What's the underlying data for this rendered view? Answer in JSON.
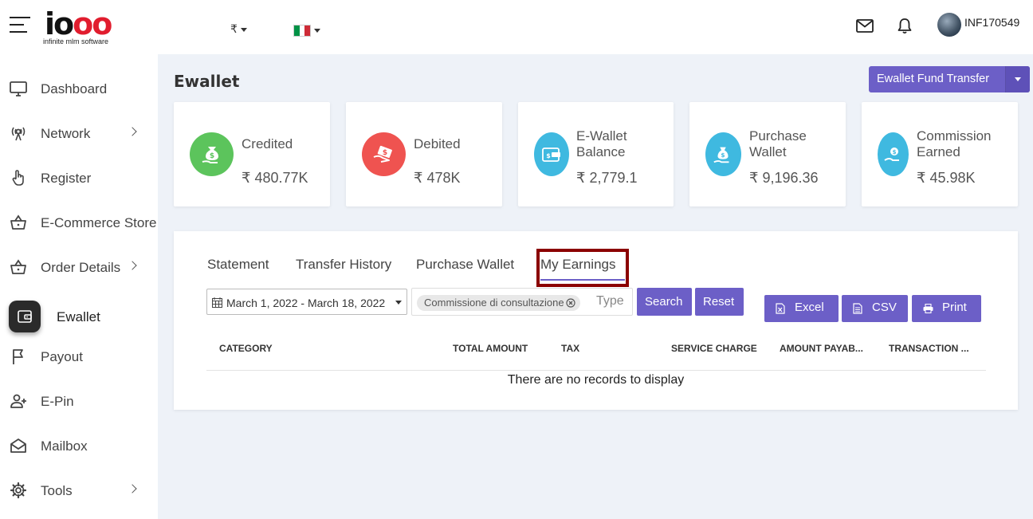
{
  "header": {
    "logo_text": "iooo",
    "logo_subtitle": "infinite mlm software",
    "currency": "₹",
    "user_id": "INF170549"
  },
  "sidebar": {
    "items": [
      {
        "label": "Dashboard",
        "icon": "monitor-icon"
      },
      {
        "label": "Network",
        "icon": "network-icon",
        "chevron": true
      },
      {
        "label": "Register",
        "icon": "hand-pointer-icon"
      },
      {
        "label": "E-Commerce Store",
        "icon": "basket-icon"
      },
      {
        "label": "Order Details",
        "icon": "basket-icon",
        "chevron": true
      },
      {
        "label": "Ewallet",
        "icon": "wallet-icon",
        "active": true
      },
      {
        "label": "Payout",
        "icon": "flag-icon"
      },
      {
        "label": "E-Pin",
        "icon": "user-plus-icon"
      },
      {
        "label": "Mailbox",
        "icon": "envelope-open-icon"
      },
      {
        "label": "Tools",
        "icon": "gear-icon",
        "chevron": true
      }
    ]
  },
  "main": {
    "page_title": "Ewallet",
    "fund_transfer_label": "Ewallet Fund Transfer",
    "cards": [
      {
        "title": "Credited",
        "value": "₹ 480.77K",
        "color": "#5cc45c"
      },
      {
        "title": "Debited",
        "value": "₹ 478K",
        "color": "#ef5350"
      },
      {
        "title": "E-Wallet Balance",
        "value": "₹ 2,779.1",
        "color": "#3fb9e0"
      },
      {
        "title": "Purchase Wallet",
        "value": "₹ 9,196.36",
        "color": "#3fb9e0"
      },
      {
        "title": "Commission Earned",
        "value": "₹ 45.98K",
        "color": "#3fb9e0"
      }
    ],
    "tabs": [
      "Statement",
      "Transfer History",
      "Purchase Wallet",
      "My Earnings"
    ],
    "active_tab": "My Earnings",
    "filters": {
      "date_range": "March 1, 2022 - March 18, 2022",
      "selected_type": "Commissione di consultazione",
      "type_placeholder": "Type",
      "search_label": "Search",
      "reset_label": "Reset"
    },
    "export": {
      "excel": "Excel",
      "csv": "CSV",
      "print": "Print"
    },
    "table": {
      "columns": [
        "CATEGORY",
        "TOTAL AMOUNT",
        "TAX",
        "SERVICE CHARGE",
        "AMOUNT PAYAB...",
        "TRANSACTION ..."
      ],
      "empty_message": "There are no records to display"
    }
  },
  "colors": {
    "accent": "#6c5fc7",
    "highlight_border": "#8b0000",
    "page_background": "#eef2f8"
  }
}
